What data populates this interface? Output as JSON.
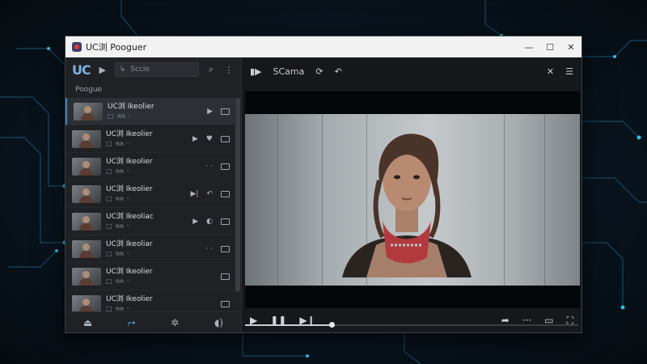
{
  "window": {
    "title": "UC浏 Pooguer",
    "minimize": "—",
    "maximize": "☐",
    "close": "✕"
  },
  "sidebar": {
    "logo": "UC",
    "search_placeholder": "Sccio",
    "section_label": "Poogue",
    "items": [
      {
        "title": "UC浏 Ikeolier",
        "sub": "□ ·ʀʀ ··",
        "actions": [
          "▶",
          "▭"
        ],
        "active": true
      },
      {
        "title": "UC浏 Ikeolier",
        "sub": "□ ·ʀʀ ··",
        "actions": [
          "▶",
          "♥",
          "▭"
        ]
      },
      {
        "title": "UC浏 Ikeolier",
        "sub": "□ ·ʀʀ ··",
        "actions": [
          "· ·",
          "▭"
        ]
      },
      {
        "title": "UC浏 Ikeolier",
        "sub": "□ ·ʀʀ ··",
        "actions": [
          "▶|",
          "↶",
          "▭"
        ]
      },
      {
        "title": "UC浏 Ikeoliac",
        "sub": "□ ·ʀʀ ··",
        "actions": [
          "▶",
          "◐",
          "▭"
        ]
      },
      {
        "title": "UC浏 Ikeoliar",
        "sub": "□ ·ʀʀ ··",
        "actions": [
          "· ·",
          "▭"
        ]
      },
      {
        "title": "UC浏 Ikeolier",
        "sub": "□ ·ʀʀ ··",
        "actions": [
          "▭"
        ]
      },
      {
        "title": "UC浏 Ikeolier",
        "sub": "□ ·ʀʀ ··",
        "actions": [
          "▭"
        ]
      }
    ]
  },
  "player": {
    "title": "SCama",
    "progress": 0.26
  }
}
